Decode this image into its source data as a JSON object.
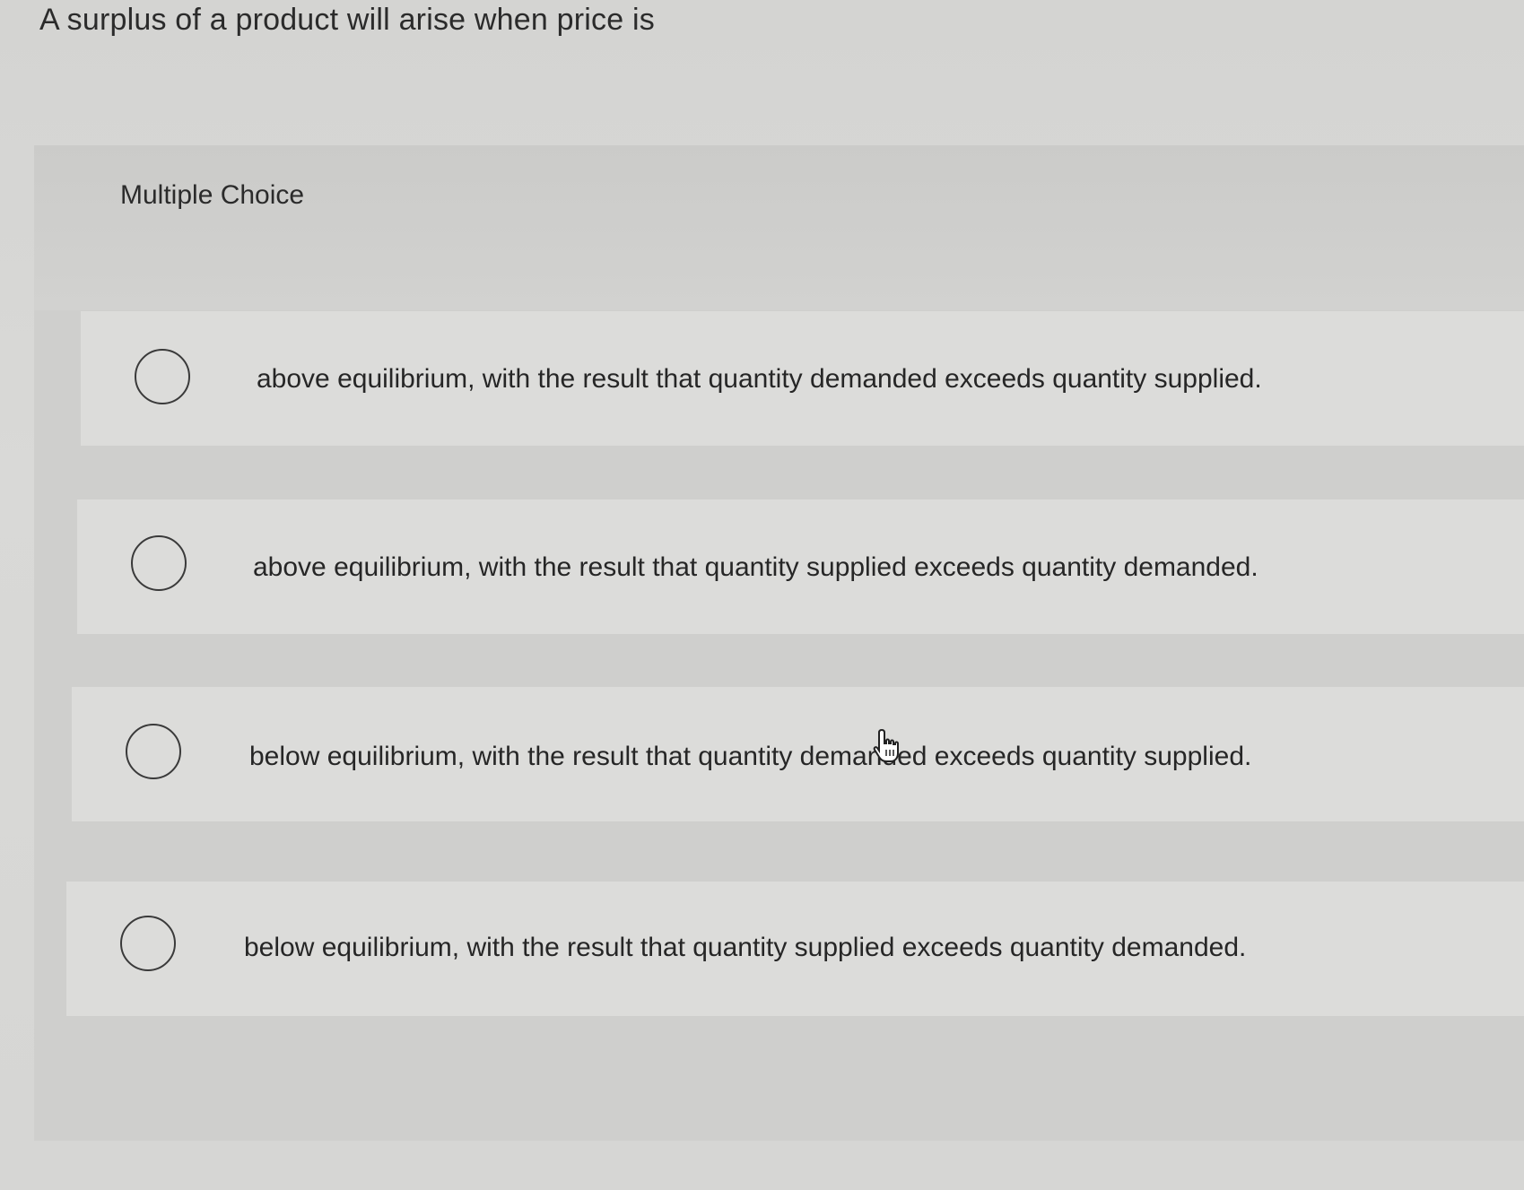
{
  "question": {
    "text": "A surplus of a product will arise when price is"
  },
  "panel": {
    "label": "Multiple Choice"
  },
  "options": [
    {
      "text": "above equilibrium, with the result that quantity demanded exceeds quantity supplied.",
      "selected": false
    },
    {
      "text": "above equilibrium, with the result that quantity supplied exceeds quantity demanded.",
      "selected": false
    },
    {
      "text": "below equilibrium, with the result that quantity demanded exceeds quantity supplied.",
      "selected": false
    },
    {
      "text": "below equilibrium, with the result that quantity supplied exceeds quantity demanded.",
      "selected": false
    }
  ],
  "cursor": {
    "icon": "hand-pointer-icon"
  }
}
